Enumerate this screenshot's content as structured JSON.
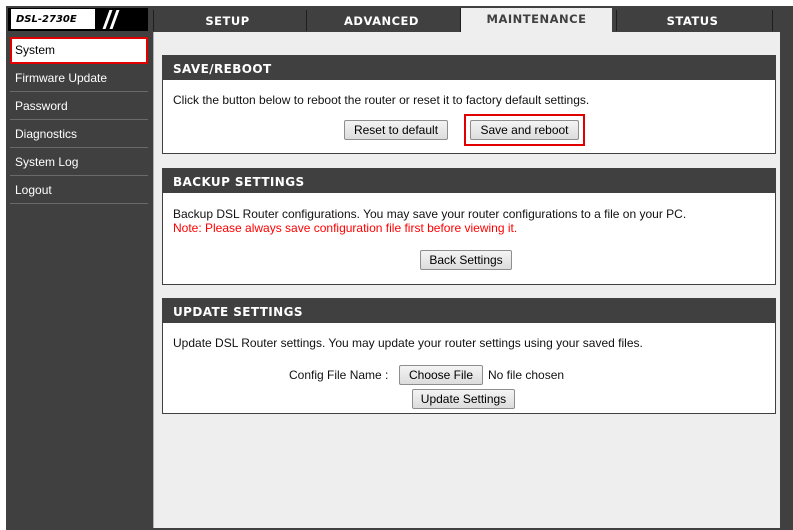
{
  "header": {
    "model": "DSL-2730E",
    "tabs": [
      {
        "label": "SETUP"
      },
      {
        "label": "ADVANCED"
      },
      {
        "label": "MAINTENANCE"
      },
      {
        "label": "STATUS"
      }
    ],
    "active_tab": "MAINTENANCE"
  },
  "sidebar": {
    "items": [
      {
        "label": "System"
      },
      {
        "label": "Firmware Update"
      },
      {
        "label": "Password"
      },
      {
        "label": "Diagnostics"
      },
      {
        "label": "System Log"
      },
      {
        "label": "Logout"
      }
    ],
    "selected": "System"
  },
  "save_reboot": {
    "title": "SAVE/REBOOT",
    "description": "Click the button below to reboot the router or reset it to factory default settings.",
    "reset_label": "Reset to default",
    "save_label": "Save and reboot"
  },
  "backup": {
    "title": "BACKUP SETTINGS",
    "description": "Backup DSL Router configurations. You may save your router configurations to a file on your PC.",
    "note": "Note: Please always save configuration file first before viewing it.",
    "button_label": "Back Settings"
  },
  "update": {
    "title": "UPDATE SETTINGS",
    "description": "Update DSL Router settings. You may update your router settings using your saved files.",
    "config_label": "Config File Name :",
    "choose_label": "Choose File",
    "file_status": "No file chosen",
    "button_label": "Update Settings"
  },
  "colors": {
    "dark_bar": "#404040",
    "content_bg": "#eeeeee",
    "highlight": "#e00000",
    "note": "#ff0000"
  }
}
